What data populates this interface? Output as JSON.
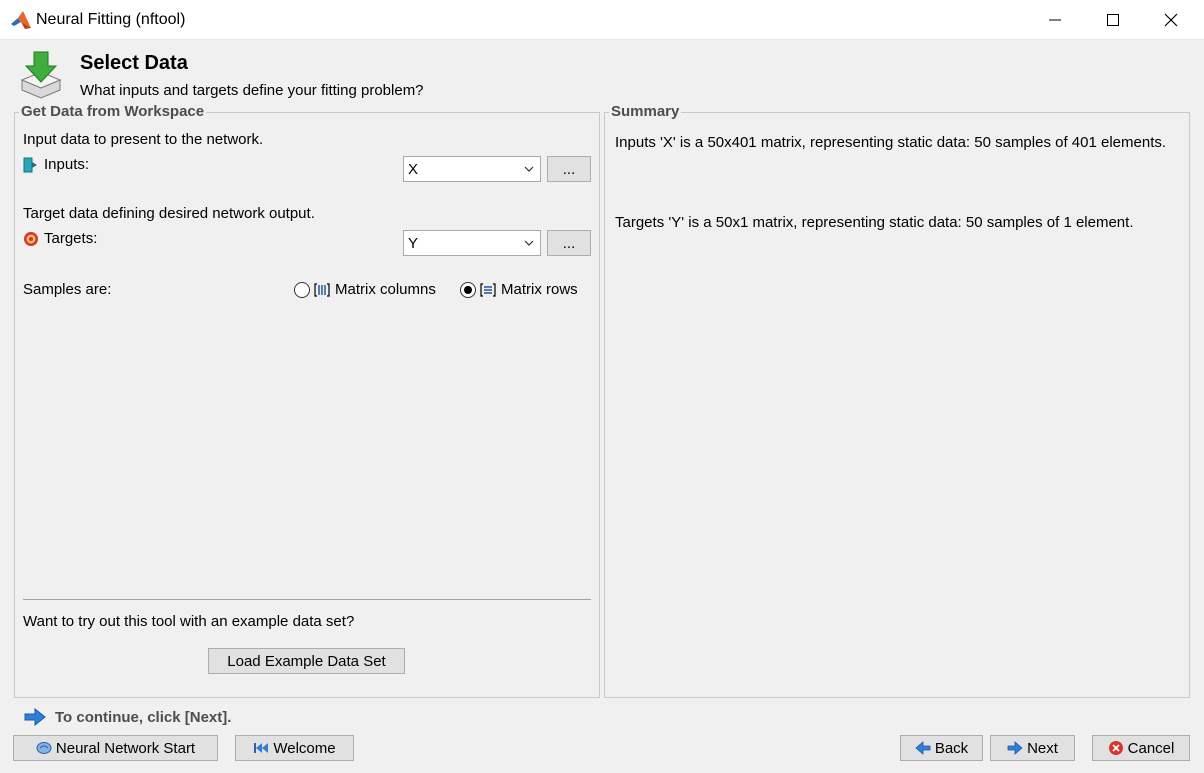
{
  "window": {
    "title": "Neural Fitting (nftool)"
  },
  "header": {
    "title": "Select Data",
    "subtitle": "What inputs and targets define your fitting problem?"
  },
  "left_panel": {
    "legend": "Get Data from Workspace",
    "inputs_desc": "Input data to present to the network.",
    "inputs_label": "Inputs:",
    "inputs_value": "X",
    "targets_desc": "Target data defining desired network output.",
    "targets_label": "Targets:",
    "targets_value": "Y",
    "browse_label": "...",
    "samples_label": "Samples are:",
    "option_columns": "Matrix columns",
    "option_rows": "Matrix rows",
    "selected_option": "Matrix rows",
    "example_prompt": "Want to try out this tool with an example data set?",
    "load_example_label": "Load Example Data Set"
  },
  "right_panel": {
    "legend": "Summary",
    "inputs_summary": "Inputs 'X' is a 50x401 matrix, representing static data: 50 samples of 401 elements.",
    "targets_summary": "Targets 'Y' is a 50x1 matrix, representing static data: 50 samples of 1 element."
  },
  "footer": {
    "hint": "To continue, click [Next].",
    "nn_start_label": "Neural Network Start",
    "welcome_label": "Welcome",
    "back_label": "Back",
    "next_label": "Next",
    "cancel_label": "Cancel"
  },
  "colors": {
    "accent_blue": "#2f7fd8",
    "cancel_red": "#d9342b",
    "group_border": "#c8c8c8",
    "legend_text": "#4d4d4d"
  }
}
